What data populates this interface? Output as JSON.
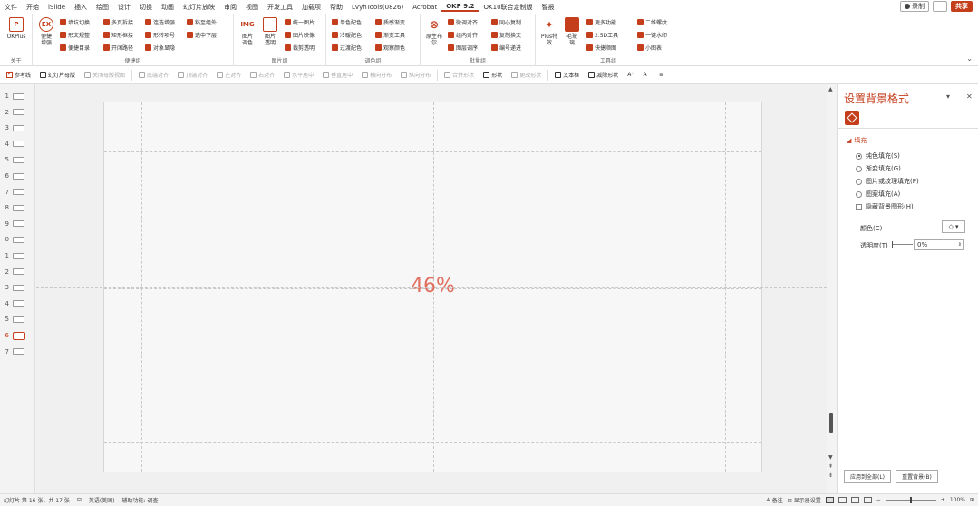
{
  "menubar": {
    "items": [
      "文件",
      "开始",
      "iSlide",
      "插入",
      "绘图",
      "设计",
      "切换",
      "动画",
      "幻灯片放映",
      "审阅",
      "视图",
      "开发工具",
      "加载项",
      "帮助",
      "LvyhTools(0826)",
      "Acrobat",
      "OKP 9.2",
      "OK10联合定制版",
      "智报"
    ],
    "active_index": 16,
    "record_label": "录制",
    "share_label": "共享"
  },
  "ribbon": {
    "group_about": {
      "label": "关于",
      "okplus": "OKPlus"
    },
    "group_convenience": {
      "label": "便捷组",
      "big": "便捷\n增强",
      "items": [
        "填坑切换",
        "多页拆接",
        "连选增强",
        "粘至组外",
        "形文规整",
        "矩形框接",
        "形转项号",
        "选中下层",
        "便捷目录",
        "开闭路径",
        "对象显隐"
      ]
    },
    "group_image": {
      "label": "图片组",
      "img_adjust": "图片\n调色",
      "img_transparent": "图片\n透明",
      "items": [
        "统一图片",
        "图片映像",
        "裁剪透明"
      ]
    },
    "group_color": {
      "label": "调色组",
      "items": [
        "单色配色",
        "质感渐变",
        "冷暖配色",
        "渐变工具",
        "过渡配色",
        "观察颜色"
      ]
    },
    "group_batch": {
      "label": "批量组",
      "big": "原生布\n尔",
      "items": [
        "微调对齐",
        "同心复制",
        "组内对齐",
        "复制换文",
        "图层调序",
        "编号递进"
      ]
    },
    "group_tools": {
      "label": "工具组",
      "plus_effects": "Plus特\n效",
      "brush": "毛玻\n璃",
      "items": [
        "更多功能",
        "二维螺纹",
        "2.5D工具",
        "一键水印",
        "快捷顺图",
        "小图表"
      ]
    }
  },
  "toolbar2": {
    "items": [
      {
        "label": "参考线",
        "checked": true
      },
      {
        "label": "幻灯片母版"
      },
      {
        "label": "关闭母版视图",
        "disabled": true
      },
      {
        "label": "底端对齐",
        "disabled": true
      },
      {
        "label": "顶端对齐",
        "disabled": true
      },
      {
        "label": "左对齐",
        "disabled": true
      },
      {
        "label": "右对齐",
        "disabled": true
      },
      {
        "label": "水平居中",
        "disabled": true
      },
      {
        "label": "垂直居中",
        "disabled": true
      },
      {
        "label": "横向分布",
        "disabled": true
      },
      {
        "label": "纵向分布",
        "disabled": true
      },
      {
        "label": "合并形状",
        "disabled": true
      },
      {
        "label": "形状"
      },
      {
        "label": "更改形状",
        "disabled": true
      },
      {
        "label": "文本框"
      },
      {
        "label": "减除形状"
      },
      {
        "label": "A⁺"
      },
      {
        "label": "A⁻"
      },
      {
        "label": "≡"
      }
    ]
  },
  "thumbnails": {
    "numbers": [
      "1",
      "2",
      "3",
      "4",
      "5",
      "6",
      "7",
      "8",
      "9",
      "0",
      "1",
      "2",
      "3",
      "4",
      "5",
      "6",
      "7"
    ],
    "selected_index": 15
  },
  "slide": {
    "text": "46%",
    "text_color": "#e06f5f"
  },
  "pane": {
    "title": "设置背景格式",
    "section": "填充",
    "options": [
      "纯色填充(S)",
      "渐变填充(G)",
      "图片或纹理填充(P)",
      "图案填充(A)"
    ],
    "selected_option": 0,
    "hide_bg": "隐藏背景图形(H)",
    "color_label": "颜色(C)",
    "transparency_label": "透明度(T)",
    "transparency_value": "0%",
    "apply_all": "应用到全部(L)",
    "reset": "重置背景(B)"
  },
  "status": {
    "slide_info": "幻灯片 第 16 张，共 17 张",
    "language": "英语(美国)",
    "accessibility": "辅助功能: 调查",
    "notes": "备注",
    "display_settings": "显示器设置",
    "zoom": "100%"
  },
  "colors": {
    "accent": "#c43e1c"
  }
}
